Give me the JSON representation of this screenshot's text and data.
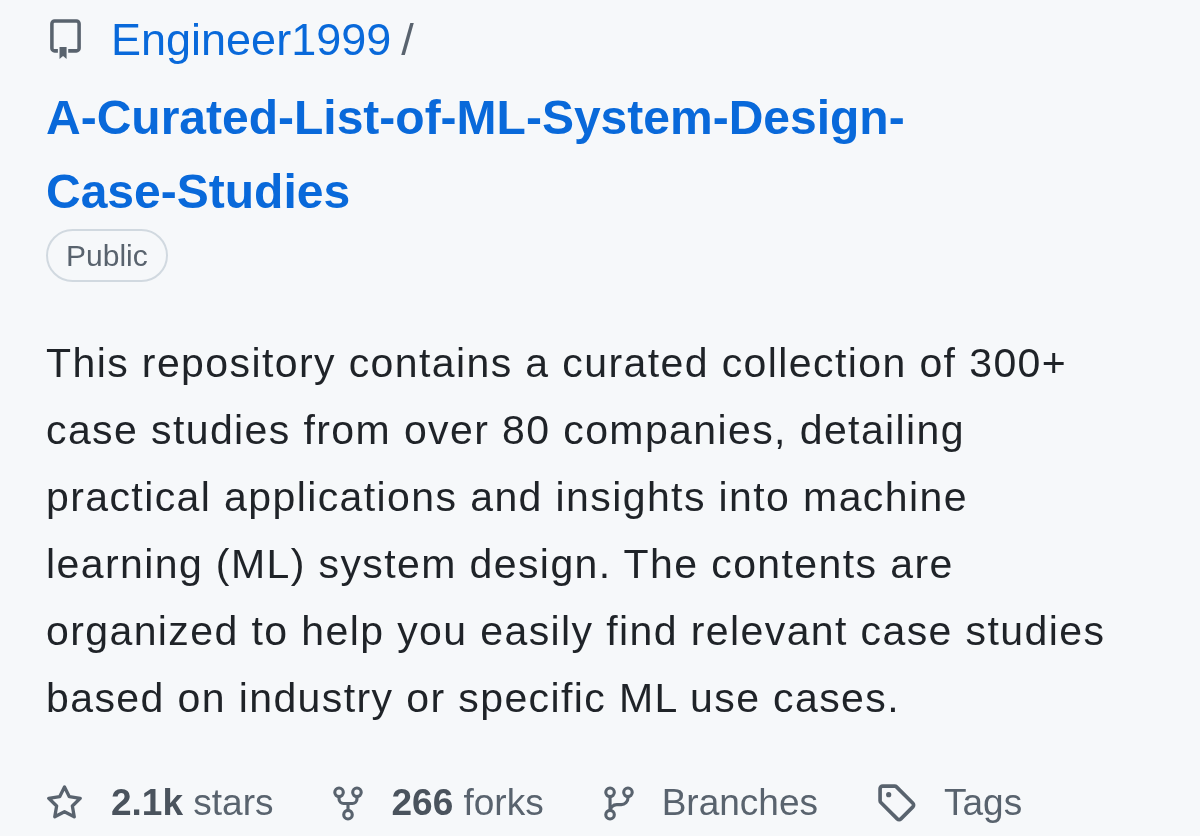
{
  "repo": {
    "owner": "Engineer1999",
    "separator": "/",
    "name": "A-Curated-List-of-ML-System-Design-Case-Studies",
    "visibility": "Public"
  },
  "description": "This repository contains a curated collection of 300+ case studies from over 80 companies, detailing practical applications and insights into machine learning (ML) system design. The contents are organized to help you easily find relevant case studies based on industry or specific ML use cases.",
  "stats": [
    {
      "kind": "stars",
      "count": "2.1k",
      "label": "stars"
    },
    {
      "kind": "forks",
      "count": "266",
      "label": "forks"
    },
    {
      "kind": "branches",
      "label": "Branches"
    },
    {
      "kind": "tags",
      "label": "Tags"
    }
  ]
}
